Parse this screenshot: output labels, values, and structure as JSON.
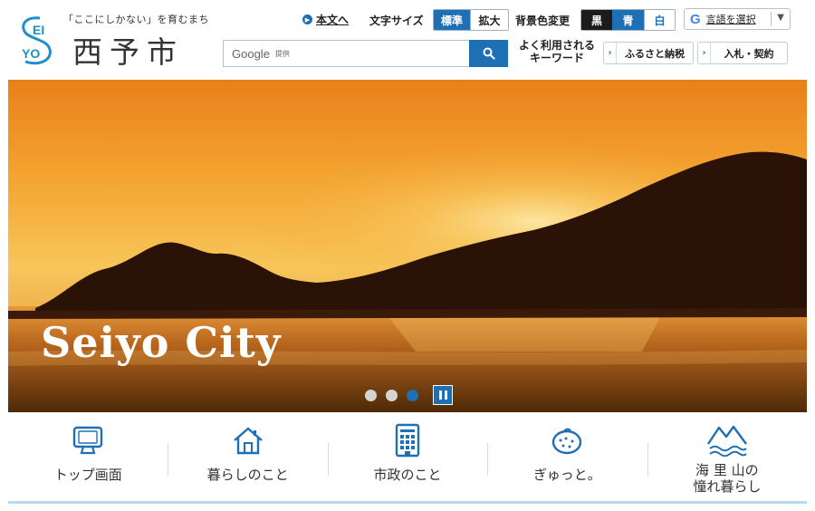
{
  "header": {
    "logo_letters": "SEIYO",
    "tagline": "「ここにしかない」を育むまち",
    "city_name": "西予市"
  },
  "utility": {
    "skip_link": "本文へ",
    "font_size_label": "文字サイズ",
    "font_size_options": [
      "標準",
      "拡大"
    ],
    "font_size_selected": "標準",
    "bg_color_label": "背景色変更",
    "bg_color_options": [
      "黒",
      "青",
      "白"
    ],
    "lang_select_label": "言語を選択"
  },
  "search": {
    "brand": "Google",
    "provided_by": "提供",
    "value": ""
  },
  "keywords": {
    "label_line1": "よく利用される",
    "label_line2": "キーワード",
    "items": [
      "ふるさと納税",
      "入札・契約"
    ]
  },
  "hero": {
    "title": "Seiyo City",
    "slide_count": 3,
    "active_slide": 3
  },
  "nav": {
    "tiles": [
      {
        "label": "トップ画面",
        "icon": "monitor-icon"
      },
      {
        "label": "暮らしのこと",
        "icon": "house-icon"
      },
      {
        "label": "市政のこと",
        "icon": "building-icon"
      },
      {
        "label": "ぎゅっと。",
        "icon": "citrus-icon"
      },
      {
        "label_line1": "海 里 山の",
        "label_line2": "憧れ暮らし",
        "icon": "mountain-sea-icon"
      }
    ]
  },
  "colors": {
    "accent": "#1f6fb5",
    "nav_underline": "#b5dcf3"
  }
}
